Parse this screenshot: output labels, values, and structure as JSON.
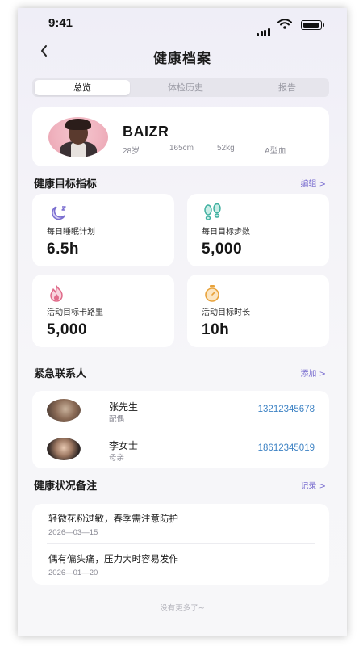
{
  "status_bar": {
    "time": "9:41"
  },
  "header": {
    "back_icon": "chevron-left-icon",
    "title": "健康档案"
  },
  "tabs": [
    {
      "label": "总览",
      "active": true
    },
    {
      "label": "体检历史",
      "active": false
    },
    {
      "label": "报告",
      "active": false
    }
  ],
  "profile": {
    "name": "BAIZR",
    "age": "28岁",
    "height": "165cm",
    "weight": "52kg",
    "blood_type": "A型血"
  },
  "goals_section": {
    "title": "健康目标指标",
    "link": "编辑 >"
  },
  "goals": [
    {
      "icon": "moon-sleep-icon",
      "label": "每日睡眠计划",
      "value": "6.5h",
      "color": "#7b6fd0"
    },
    {
      "icon": "footprints-icon",
      "label": "每日目标步数",
      "value": "5,000",
      "color": "#3fb0a0"
    },
    {
      "icon": "flame-icon",
      "label": "活动目标卡路里",
      "value": "5,000",
      "color": "#e06b8a"
    },
    {
      "icon": "stopwatch-icon",
      "label": "活动目标时长",
      "value": "10h",
      "color": "#e8a23a"
    }
  ],
  "contacts_section": {
    "title": "紧急联系人",
    "link": "添加 >"
  },
  "contacts": [
    {
      "name": "张先生",
      "relation": "配偶",
      "phone": "13212345678"
    },
    {
      "name": "李女士",
      "relation": "母亲",
      "phone": "18612345019"
    }
  ],
  "notes_section": {
    "title": "健康状况备注",
    "link": "记录 >"
  },
  "notes": [
    {
      "text": "轻微花粉过敏，春季需注意防护",
      "date": "2026—03—15"
    },
    {
      "text": "偶有偏头痛，压力大时容易发作",
      "date": "2026—01—20"
    }
  ],
  "footer": "没有更多了~",
  "colors": {
    "accent": "#7b6fd0",
    "phone_link": "#3d82c4"
  }
}
